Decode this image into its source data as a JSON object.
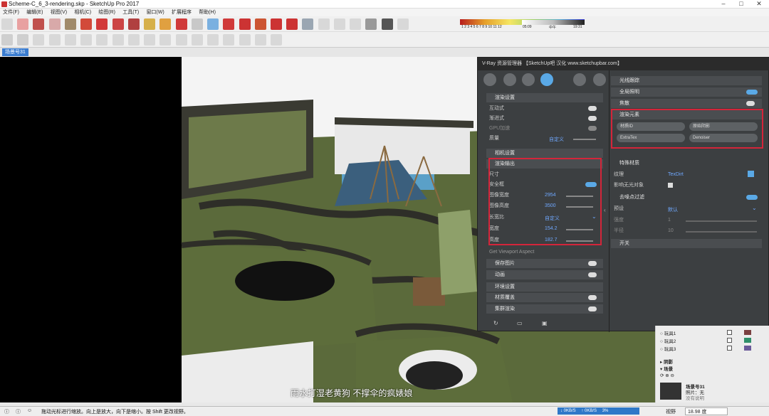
{
  "window": {
    "title": "Scheme-C_6_3-rendering.skp - SketchUp Pro 2017",
    "controls": [
      "–",
      "□",
      "✕"
    ]
  },
  "menu": [
    "文件(F)",
    "编辑(E)",
    "视图(V)",
    "相机(C)",
    "绘图(R)",
    "工具(T)",
    "窗口(W)",
    "扩展程序",
    "帮助(H)"
  ],
  "toolbar": {
    "shadow_scale_numbers": "1 2 3 4 5 6 7 8 9 10 11 12",
    "time_start": "05:09",
    "time_mid": "中午",
    "time_end": "19:31"
  },
  "scene_tab": "场景号31",
  "vray": {
    "title": "V-Ray 资源管理器 【SketchUp吧 汉化 www.sketchupbar.com】",
    "left": {
      "render_settings": "渲染设置",
      "interactive": "互动式",
      "progressive": "渐进式",
      "gpu": "GPU加速",
      "quality_label": "质量",
      "quality_value": "自定义",
      "camera_settings": "相机设置",
      "render_output": "渲染输出",
      "size": "尺寸",
      "safe_frame": "安全框",
      "image_width_label": "图像宽度",
      "image_width": "2954",
      "image_height_label": "图像高度",
      "image_height": "3500",
      "aspect_label": "长宽比",
      "aspect_value": "自定义",
      "width_label": "宽度",
      "width_value": "154.2",
      "height_label": "高度",
      "height_value": "182.7",
      "viewport_aspect": "Get Viewport Aspect",
      "save_image": "保存图片",
      "animation": "动画",
      "environment": "环境设置",
      "material_override": "材质覆盖",
      "swarm": "集群渲染"
    },
    "right": {
      "raytrace": "光线跟踪",
      "gi": "全局照明",
      "caustics": "焦散",
      "render_elements": "渲染元素",
      "elements": [
        "材质ID",
        "原始阴影",
        "ExtraTex",
        "Denoiser"
      ],
      "extratex_title": "特殊材质",
      "texture_label": "纹理",
      "texture_value": "TexDirt",
      "affect_label": "影响无光对象",
      "denoiser_title": "去噪点过滤",
      "preset_label": "预设",
      "preset_value": "默认",
      "strength_label": "强度",
      "strength_value": "1",
      "radius_label": "半径",
      "radius_value": "10",
      "switch": "开关"
    }
  },
  "dock": {
    "layers": [
      {
        "name": "玩具1",
        "checked": true
      },
      {
        "name": "玩具2",
        "checked": true
      },
      {
        "name": "玩具3",
        "checked": true
      }
    ],
    "shadow_label": "阴影",
    "scenes_label": "场景",
    "scene_name": "场景号31",
    "scene_photo_label": "照片：无",
    "scene_desc": "没有说明"
  },
  "caption": "雨水打湿老黄狗 不撑伞的疯婊娘",
  "status": {
    "hint": "拖动光标进行缩放。向上是放大，向下是缩小。按 Shift 更改视野。",
    "down": "0KB/S",
    "up": "0KB/S",
    "cpu": "3%",
    "fov_label": "视野",
    "fov_value": "18.98 度"
  },
  "colors": {
    "accent_red": "#d4253a",
    "toggle_blue": "#5aa9e6",
    "value_blue": "#6fa8ff",
    "panel_bg": "#3c3f41"
  }
}
